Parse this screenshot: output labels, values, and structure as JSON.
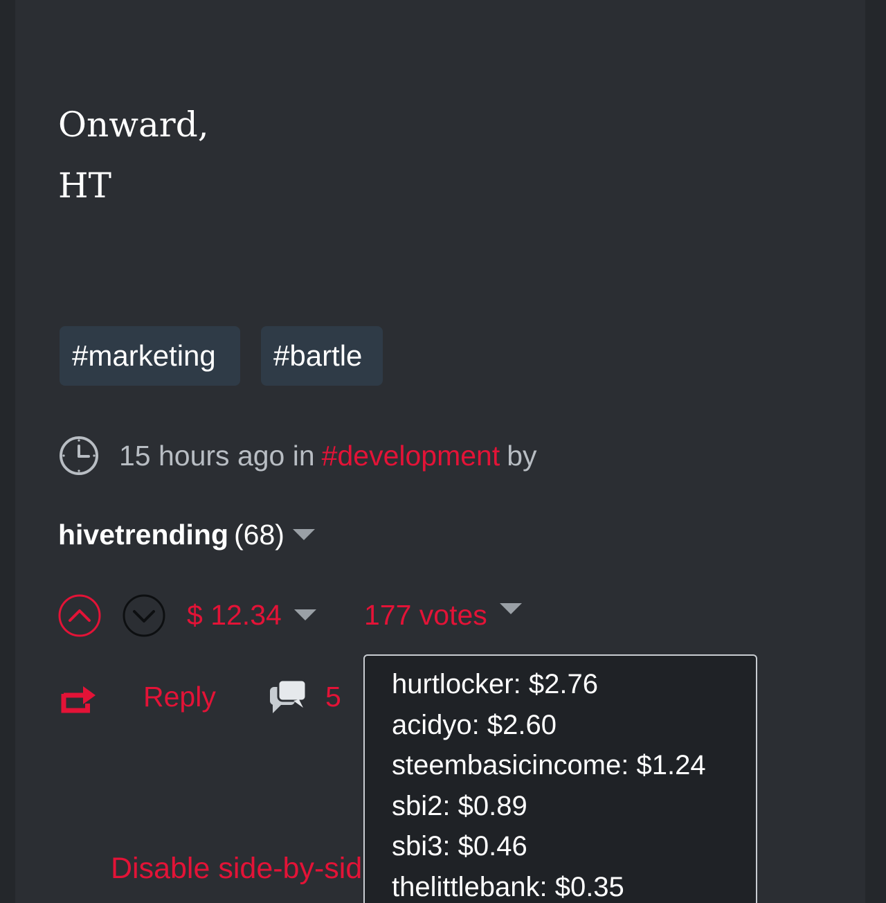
{
  "post": {
    "signoff_line1": "Onward,",
    "signoff_line2": "HT",
    "tags": [
      "#marketing",
      "#bartle"
    ],
    "time_ago": "15 hours ago in",
    "category": "#development",
    "by": "by",
    "author": "hivetrending",
    "author_rep": "(68)",
    "payout": "$ 12.34",
    "votes_label": "177 votes",
    "reply_label": "Reply",
    "comment_count": "5",
    "side_by_side_label": "Disable side-by-side"
  },
  "voters_popup": {
    "items": [
      "hurtlocker: $2.76",
      "acidyo: $2.60",
      "steembasicincome: $1.24",
      "sbi2: $0.89",
      "sbi3: $0.46",
      "thelittlebank: $0.35"
    ]
  },
  "colors": {
    "accent": "#e31337",
    "background": "#2b2e33",
    "tag_bg": "#2f3b47",
    "muted_text": "#b8bdc3"
  },
  "icons": {
    "clock": "clock-icon",
    "upvote": "chevron-up-circle-icon",
    "downvote": "chevron-down-circle-icon",
    "reblog": "reblog-icon",
    "comments": "comments-icon",
    "caret": "caret-down-icon"
  }
}
